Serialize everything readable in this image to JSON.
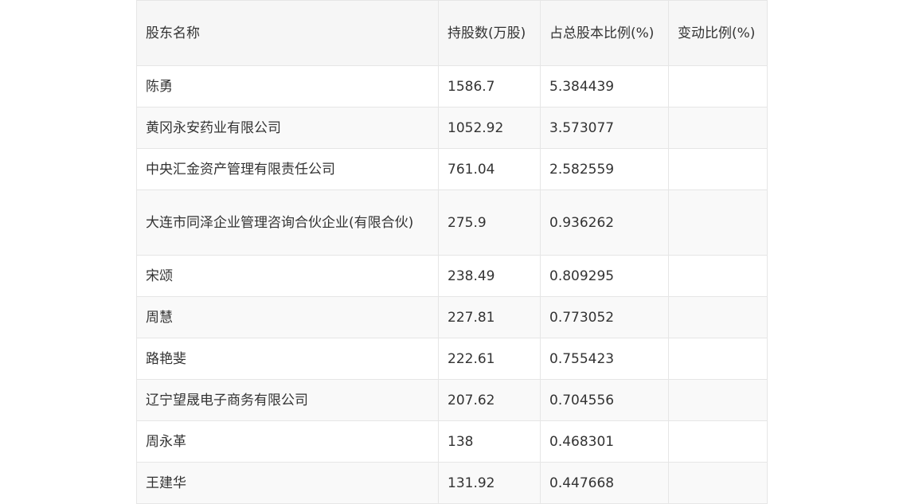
{
  "table": {
    "headers": [
      "股东名称",
      "持股数(万股)",
      "占总股本比例(%)",
      "变动比例(%)"
    ],
    "rows": [
      [
        "陈勇",
        "1586.7",
        "5.384439",
        ""
      ],
      [
        "黄冈永安药业有限公司",
        "1052.92",
        "3.573077",
        ""
      ],
      [
        "中央汇金资产管理有限责任公司",
        "761.04",
        "2.582559",
        ""
      ],
      [
        "大连市同泽企业管理咨询合伙企业(有限合伙)",
        "275.9",
        "0.936262",
        ""
      ],
      [
        "宋颂",
        "238.49",
        "0.809295",
        ""
      ],
      [
        "周慧",
        "227.81",
        "0.773052",
        ""
      ],
      [
        "路艳斐",
        "222.61",
        "0.755423",
        ""
      ],
      [
        "辽宁望晟电子商务有限公司",
        "207.62",
        "0.704556",
        ""
      ],
      [
        "周永革",
        "138",
        "0.468301",
        ""
      ],
      [
        "王建华",
        "131.92",
        "0.447668",
        ""
      ]
    ]
  }
}
